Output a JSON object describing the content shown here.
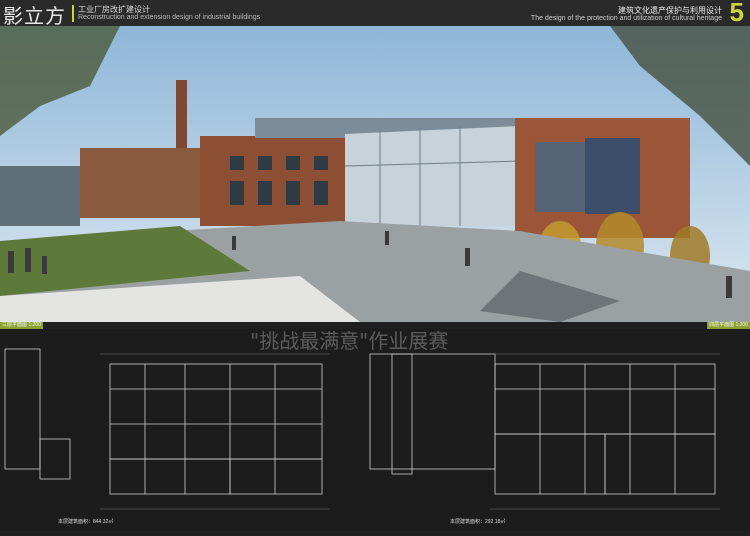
{
  "header": {
    "logo": "影立方",
    "subtitle_cn": "工业厂房改扩建设计",
    "subtitle_en": "Reconstruction and extension design of industrial buildings",
    "right_cn": "建筑文化遗产保护与利用设计",
    "right_en": "The design of the protection and utilization of cultural heritage",
    "page_number": "5"
  },
  "labels": {
    "left_plan": "三层平面图 1:200",
    "right_plan": "四层平面图 1:200",
    "left_area": "本层建筑面积：844.32㎡",
    "right_area": "本层建筑面积：292.18㎡"
  },
  "watermark": "\"挑战最满意\"作业展赛",
  "colors": {
    "accent": "#8da230",
    "brand_green": "#c9d63a"
  }
}
